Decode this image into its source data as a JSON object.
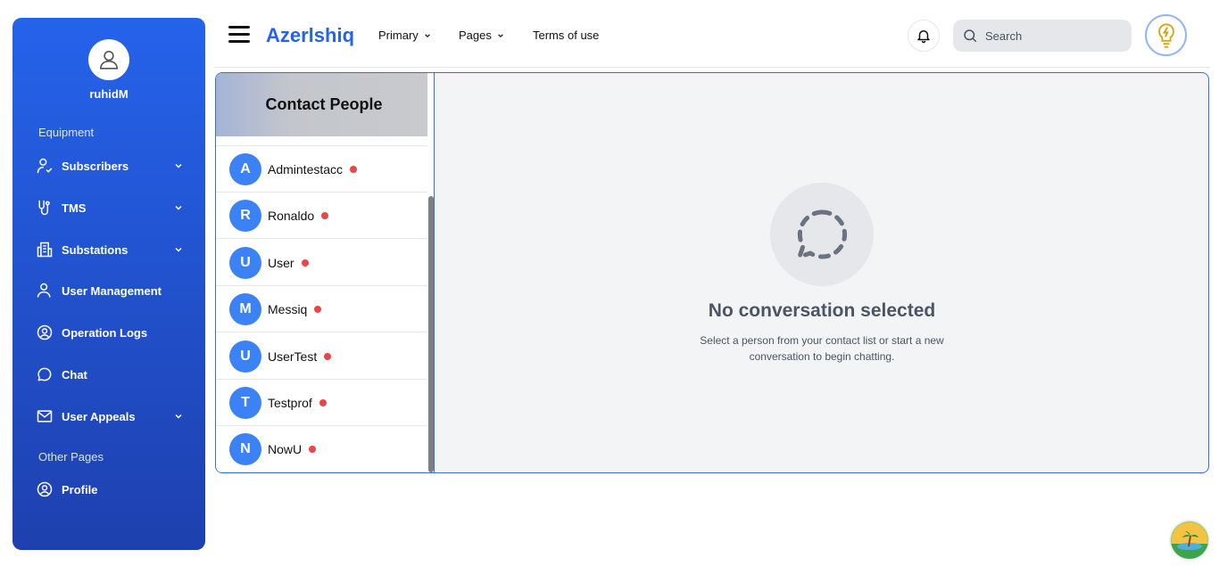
{
  "sidebar": {
    "username": "ruhidM",
    "section_equipment": "Equipment",
    "section_other": "Other Pages",
    "items": [
      {
        "label": "Subscribers",
        "icon": "user-check-icon",
        "has_chevron": true
      },
      {
        "label": "TMS",
        "icon": "route-icon",
        "has_chevron": true
      },
      {
        "label": "Substations",
        "icon": "building-icon",
        "has_chevron": true
      },
      {
        "label": "User Management",
        "icon": "user-icon",
        "has_chevron": false
      },
      {
        "label": "Operation Logs",
        "icon": "user-circle-icon",
        "has_chevron": false
      },
      {
        "label": "Chat",
        "icon": "chat-bubble-icon",
        "has_chevron": false
      },
      {
        "label": "User Appeals",
        "icon": "mail-icon",
        "has_chevron": true
      },
      {
        "label": "Profile",
        "icon": "user-circle-icon",
        "has_chevron": false
      }
    ]
  },
  "header": {
    "brand": "Azerlshiq",
    "nav": [
      {
        "label": "Primary",
        "has_chevron": true
      },
      {
        "label": "Pages",
        "has_chevron": true
      },
      {
        "label": "Terms of use",
        "has_chevron": false
      }
    ],
    "search_placeholder": "Search"
  },
  "contacts": {
    "title": "Contact People",
    "list": [
      {
        "initial": "A",
        "name": "Admintestacc",
        "status": "offline"
      },
      {
        "initial": "R",
        "name": "Ronaldo",
        "status": "offline"
      },
      {
        "initial": "U",
        "name": "User",
        "status": "offline"
      },
      {
        "initial": "M",
        "name": "Messiq",
        "status": "offline"
      },
      {
        "initial": "U",
        "name": "UserTest",
        "status": "offline"
      },
      {
        "initial": "T",
        "name": "Testprof",
        "status": "offline"
      },
      {
        "initial": "N",
        "name": "NowU",
        "status": "offline"
      }
    ]
  },
  "empty_state": {
    "title": "No conversation selected",
    "subtitle": "Select a person from your contact list or start a new conversation to begin chatting."
  },
  "colors": {
    "accent": "#2563eb",
    "sidebar_top": "#2563eb",
    "sidebar_bottom": "#1e40af",
    "avatar_blue": "#3b82f6",
    "status_red": "#ef4444"
  }
}
